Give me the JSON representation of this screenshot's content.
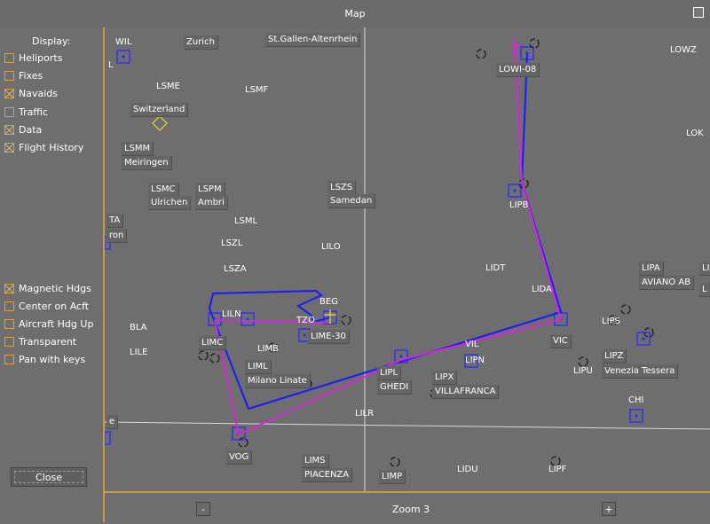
{
  "window": {
    "title": "Map"
  },
  "display": {
    "header": "Display:",
    "options": [
      {
        "label": "Heliports",
        "checked": false
      },
      {
        "label": "Fixes",
        "checked": false
      },
      {
        "label": "Navaids",
        "checked": true
      },
      {
        "label": "Traffic",
        "checked": false
      },
      {
        "label": "Data",
        "checked": true
      },
      {
        "label": "Flight History",
        "checked": true
      }
    ],
    "settings": [
      {
        "label": "Magnetic Hdgs",
        "checked": true
      },
      {
        "label": "Center on Acft",
        "checked": false
      },
      {
        "label": "Aircraft Hdg Up",
        "checked": false
      },
      {
        "label": "Transparent",
        "checked": false
      },
      {
        "label": "Pan with keys",
        "checked": false
      }
    ],
    "close_label": "Close"
  },
  "zoom": {
    "label": "Zoom 3",
    "minus": "-",
    "plus": "+"
  },
  "map_labels": [
    {
      "id": "wil",
      "text": "WIL"
    },
    {
      "id": "wil-b",
      "text": "L"
    },
    {
      "id": "zurich",
      "text": "Zurich"
    },
    {
      "id": "stgallen",
      "text": "St.Gallen-Altenrhein"
    },
    {
      "id": "lsme",
      "text": "LSME"
    },
    {
      "id": "lsmf",
      "text": "LSMF"
    },
    {
      "id": "switzerland",
      "text": "Switzerland"
    },
    {
      "id": "lsmm",
      "text": "LSMM"
    },
    {
      "id": "meiringen",
      "text": "Meiringen"
    },
    {
      "id": "lsmc",
      "text": "LSMC"
    },
    {
      "id": "ulrichen",
      "text": "Ulrichen"
    },
    {
      "id": "lspm",
      "text": "LSPM"
    },
    {
      "id": "ambri",
      "text": "Ambri"
    },
    {
      "id": "lszs",
      "text": "LSZS"
    },
    {
      "id": "samedan",
      "text": "Samedan"
    },
    {
      "id": "ta",
      "text": "TA"
    },
    {
      "id": "ron",
      "text": "ron"
    },
    {
      "id": "lsml",
      "text": "LSML"
    },
    {
      "id": "lszl",
      "text": "LSZL"
    },
    {
      "id": "lilo",
      "text": "LILO"
    },
    {
      "id": "lsza",
      "text": "LSZA"
    },
    {
      "id": "lowi",
      "text": "LOWI-08"
    },
    {
      "id": "lowz",
      "text": "LOWZ"
    },
    {
      "id": "lok",
      "text": "LOK"
    },
    {
      "id": "lipb",
      "text": "LIPB"
    },
    {
      "id": "lidt",
      "text": "LIDT"
    },
    {
      "id": "lida",
      "text": "LIDA"
    },
    {
      "id": "lipa",
      "text": "LIPA"
    },
    {
      "id": "aviano",
      "text": "AVIANO AB"
    },
    {
      "id": "li-edge",
      "text": "LI"
    },
    {
      "id": "l-edge",
      "text": "L"
    },
    {
      "id": "beg",
      "text": "BEG"
    },
    {
      "id": "liln",
      "text": "LILN"
    },
    {
      "id": "tzo",
      "text": "TZO"
    },
    {
      "id": "lime",
      "text": "LIME-30"
    },
    {
      "id": "bla",
      "text": "BLA"
    },
    {
      "id": "lile",
      "text": "LILE"
    },
    {
      "id": "limc",
      "text": "LIMC"
    },
    {
      "id": "limb",
      "text": "LIMB"
    },
    {
      "id": "liml",
      "text": "LIML"
    },
    {
      "id": "linate",
      "text": "Milano Linate"
    },
    {
      "id": "vil",
      "text": "VIL"
    },
    {
      "id": "lipl",
      "text": "LIPL"
    },
    {
      "id": "ghedi",
      "text": "GHEDI"
    },
    {
      "id": "lipn",
      "text": "LIPN"
    },
    {
      "id": "lipx",
      "text": "LIPX"
    },
    {
      "id": "villafranca",
      "text": "VILLAFRANCA"
    },
    {
      "id": "vic",
      "text": "VIC"
    },
    {
      "id": "lips",
      "text": "LIPS"
    },
    {
      "id": "lipz",
      "text": "LIPZ"
    },
    {
      "id": "tessera",
      "text": "Venezia Tessera"
    },
    {
      "id": "lipu",
      "text": "LIPU"
    },
    {
      "id": "chi",
      "text": "CHI"
    },
    {
      "id": "e-edge",
      "text": "e"
    },
    {
      "id": "lilr",
      "text": "LILR"
    },
    {
      "id": "vog",
      "text": "VOG"
    },
    {
      "id": "lims",
      "text": "LIMS"
    },
    {
      "id": "piacenza",
      "text": "PIACENZA"
    },
    {
      "id": "limp",
      "text": "LIMP"
    },
    {
      "id": "lidu",
      "text": "LIDU"
    },
    {
      "id": "lipf",
      "text": "LIPF"
    }
  ],
  "colors": {
    "background": "#6e6e6e",
    "accent": "#c89e3b",
    "flight_history": "#1a1aff",
    "route": "#e020e0",
    "navaid": "#2a2aff",
    "grid": "#d8d8d8"
  }
}
